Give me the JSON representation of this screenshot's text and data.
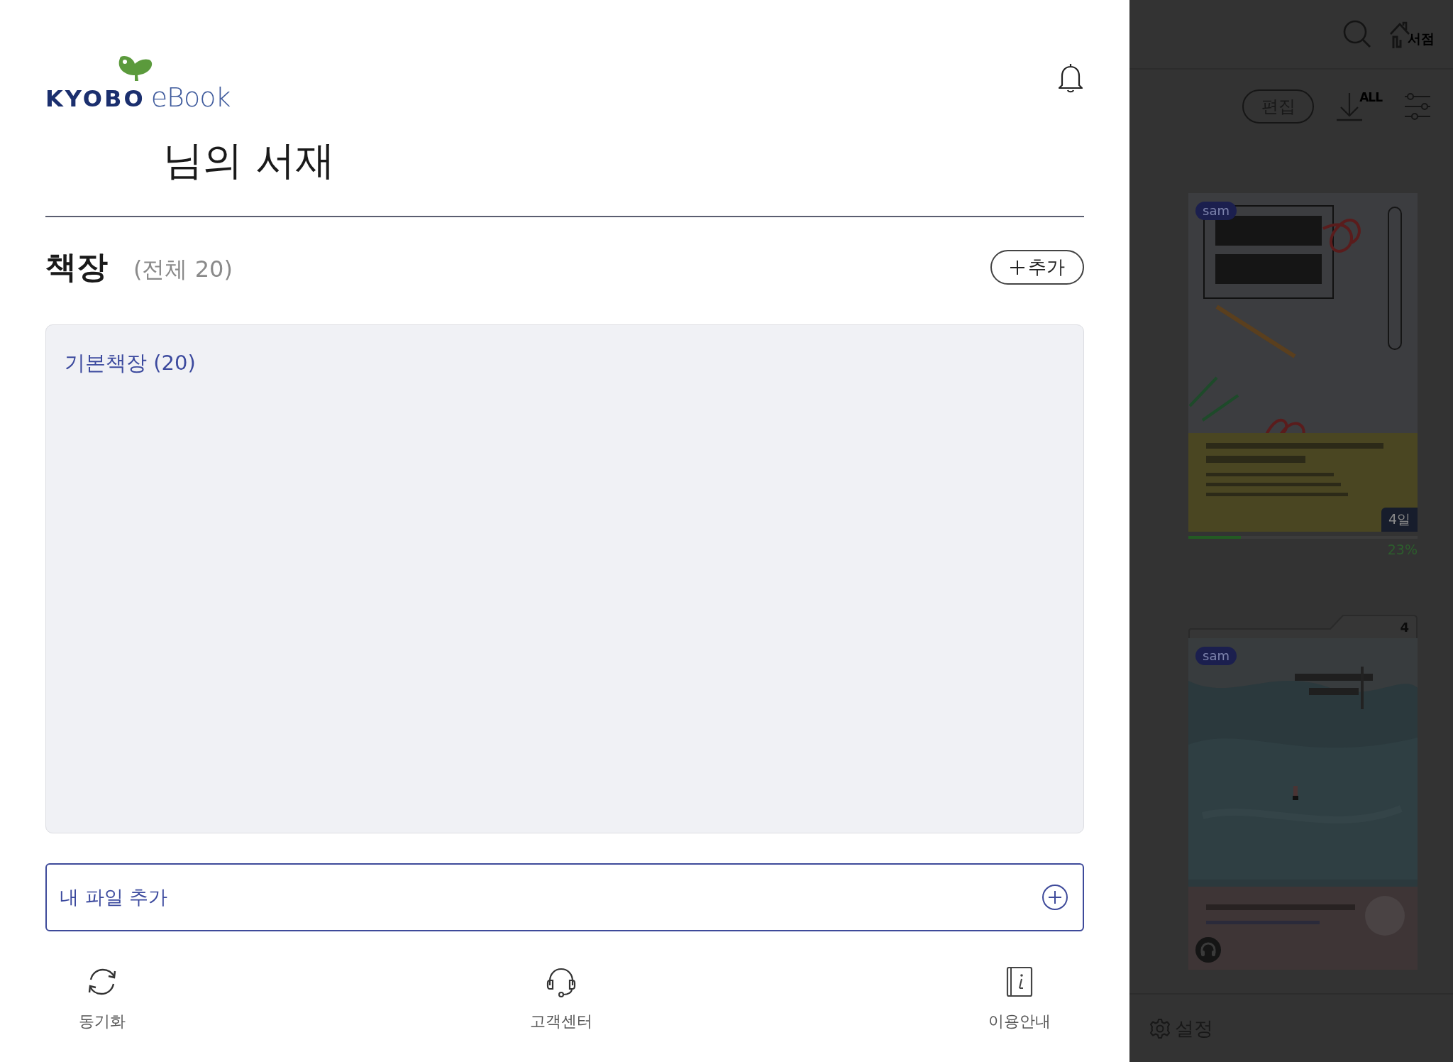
{
  "drawer": {
    "logo": {
      "brand": "KYOBO",
      "product": "eBook"
    },
    "title": "님의 서재",
    "shelf_heading": "책장",
    "shelf_count": "(전체 20)",
    "add_button": "추가",
    "shelves": [
      {
        "label": "기본책장 (20)"
      }
    ],
    "add_file": "내 파일 추가",
    "footer": [
      {
        "kind": "sync",
        "label": "동기화"
      },
      {
        "kind": "support",
        "label": "고객센터"
      },
      {
        "kind": "guide",
        "label": "이용안내"
      }
    ]
  },
  "library": {
    "store_label": "서점",
    "edit_button": "편집",
    "download_label": "ALL",
    "books": [
      {
        "kind": "single",
        "badge": "sam",
        "days": "4일",
        "level": 0.23,
        "progress": "23%",
        "audio": false
      },
      {
        "kind": "series",
        "badge": "sam",
        "count": "4",
        "audio": true
      }
    ],
    "settings": "설정"
  }
}
